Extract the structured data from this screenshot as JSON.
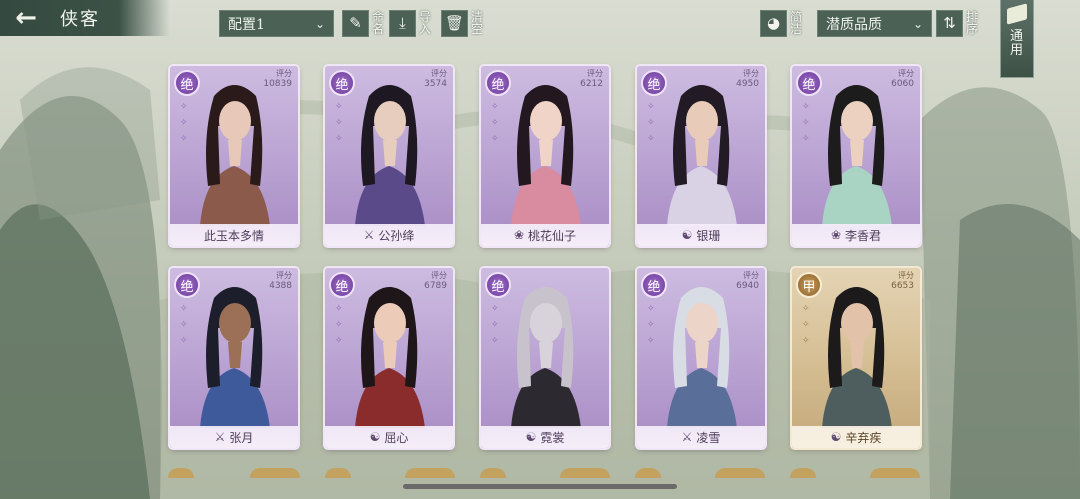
{
  "header": {
    "back_icon": "back-arrow-icon",
    "title": "侠客",
    "preset_select": "配置1",
    "rename_label": "命名",
    "import_label": "导入",
    "clear_label": "清空",
    "simple_label": "简洁",
    "sort_select": "潜质品质",
    "sort_label": "排序",
    "general_label": "通用"
  },
  "score_label": "评分",
  "cards": [
    {
      "grade": "绝",
      "score": "10839",
      "name": "此玉本多情",
      "school_icon": "",
      "tier": "jue",
      "palette": [
        "#8c5a4a",
        "#e8c8b8",
        "#2a1a1a"
      ]
    },
    {
      "grade": "绝",
      "score": "3574",
      "name": "公孙绛",
      "school_icon": "sword-icon",
      "tier": "jue",
      "palette": [
        "#5b4a8a",
        "#e6cdbd",
        "#1e1822"
      ]
    },
    {
      "grade": "绝",
      "score": "6212",
      "name": "桃花仙子",
      "school_icon": "lotus-icon",
      "tier": "jue",
      "palette": [
        "#d98ba0",
        "#f0d4c8",
        "#241820"
      ]
    },
    {
      "grade": "绝",
      "score": "4950",
      "name": "银珊",
      "school_icon": "taiji-icon",
      "tier": "jue",
      "palette": [
        "#d9d2e4",
        "#e9cbb9",
        "#221a24"
      ]
    },
    {
      "grade": "绝",
      "score": "6060",
      "name": "李香君",
      "school_icon": "lotus-icon",
      "tier": "jue",
      "palette": [
        "#a9d3c2",
        "#ecd0c0",
        "#1c1c1c"
      ]
    },
    {
      "grade": "绝",
      "score": "4388",
      "name": "张月",
      "school_icon": "sword-icon",
      "tier": "jue",
      "palette": [
        "#3f5a9a",
        "#9b7056",
        "#1c1e2c"
      ]
    },
    {
      "grade": "绝",
      "score": "6789",
      "name": "屈心",
      "school_icon": "taiji-icon",
      "tier": "jue",
      "palette": [
        "#8a2c2c",
        "#ecccb8",
        "#1e1618"
      ]
    },
    {
      "grade": "绝",
      "score": "",
      "name": "霓裳",
      "school_icon": "taiji-icon",
      "tier": "jue",
      "palette": [
        "#2c2a30",
        "#d8d2da",
        "#c8c2cc"
      ]
    },
    {
      "grade": "绝",
      "score": "6940",
      "name": "凌雪",
      "school_icon": "sword-icon",
      "tier": "jue",
      "palette": [
        "#5a6e9a",
        "#ecd4c8",
        "#d8dce4"
      ]
    },
    {
      "grade": "甲",
      "score": "6653",
      "name": "辛弃疾",
      "school_icon": "taiji-icon",
      "tier": "jia",
      "palette": [
        "#4e5d5e",
        "#e2c2a8",
        "#1c1a1a"
      ]
    }
  ]
}
